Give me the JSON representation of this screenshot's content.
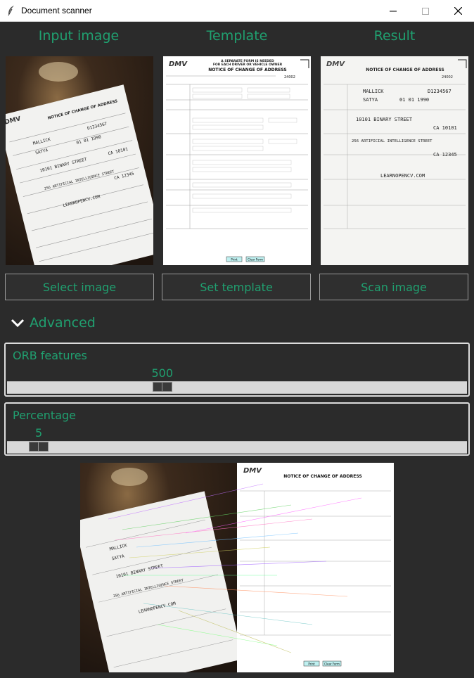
{
  "window": {
    "title": "Document scanner"
  },
  "columns": {
    "input_label": "Input image",
    "template_label": "Template",
    "result_label": "Result"
  },
  "buttons": {
    "select": "Select image",
    "template": "Set template",
    "scan": "Scan image"
  },
  "advanced": {
    "label": "Advanced"
  },
  "orb": {
    "label": "ORB features",
    "value": 500,
    "fraction": 0.33
  },
  "percentage": {
    "label": "Percentage",
    "value": 5,
    "fraction": 0.05
  },
  "form": {
    "agency": "DMV",
    "header1": "A SEPARATE FORM IS NEEDED",
    "header2": "FOR EACH DRIVER OR VEHICLE OWNER",
    "title": "NOTICE OF CHANGE OF ADDRESS",
    "code": "24002",
    "print": "Print",
    "clear": "Clear Form"
  },
  "handwriting": {
    "last": "MALLICK",
    "first": "SATYA",
    "dob": "01 01 1990",
    "dl": "D1234567",
    "street1": "10101 BINARY STREET",
    "city1": "CA 10101",
    "street2": "256 ARTIFICIAL INTELLIGENCE STREET",
    "city2": "CA 12345",
    "web": "LEARNOPENCV.COM"
  },
  "colors": {
    "accent": "#20a070",
    "bg": "#2b2b2b"
  }
}
